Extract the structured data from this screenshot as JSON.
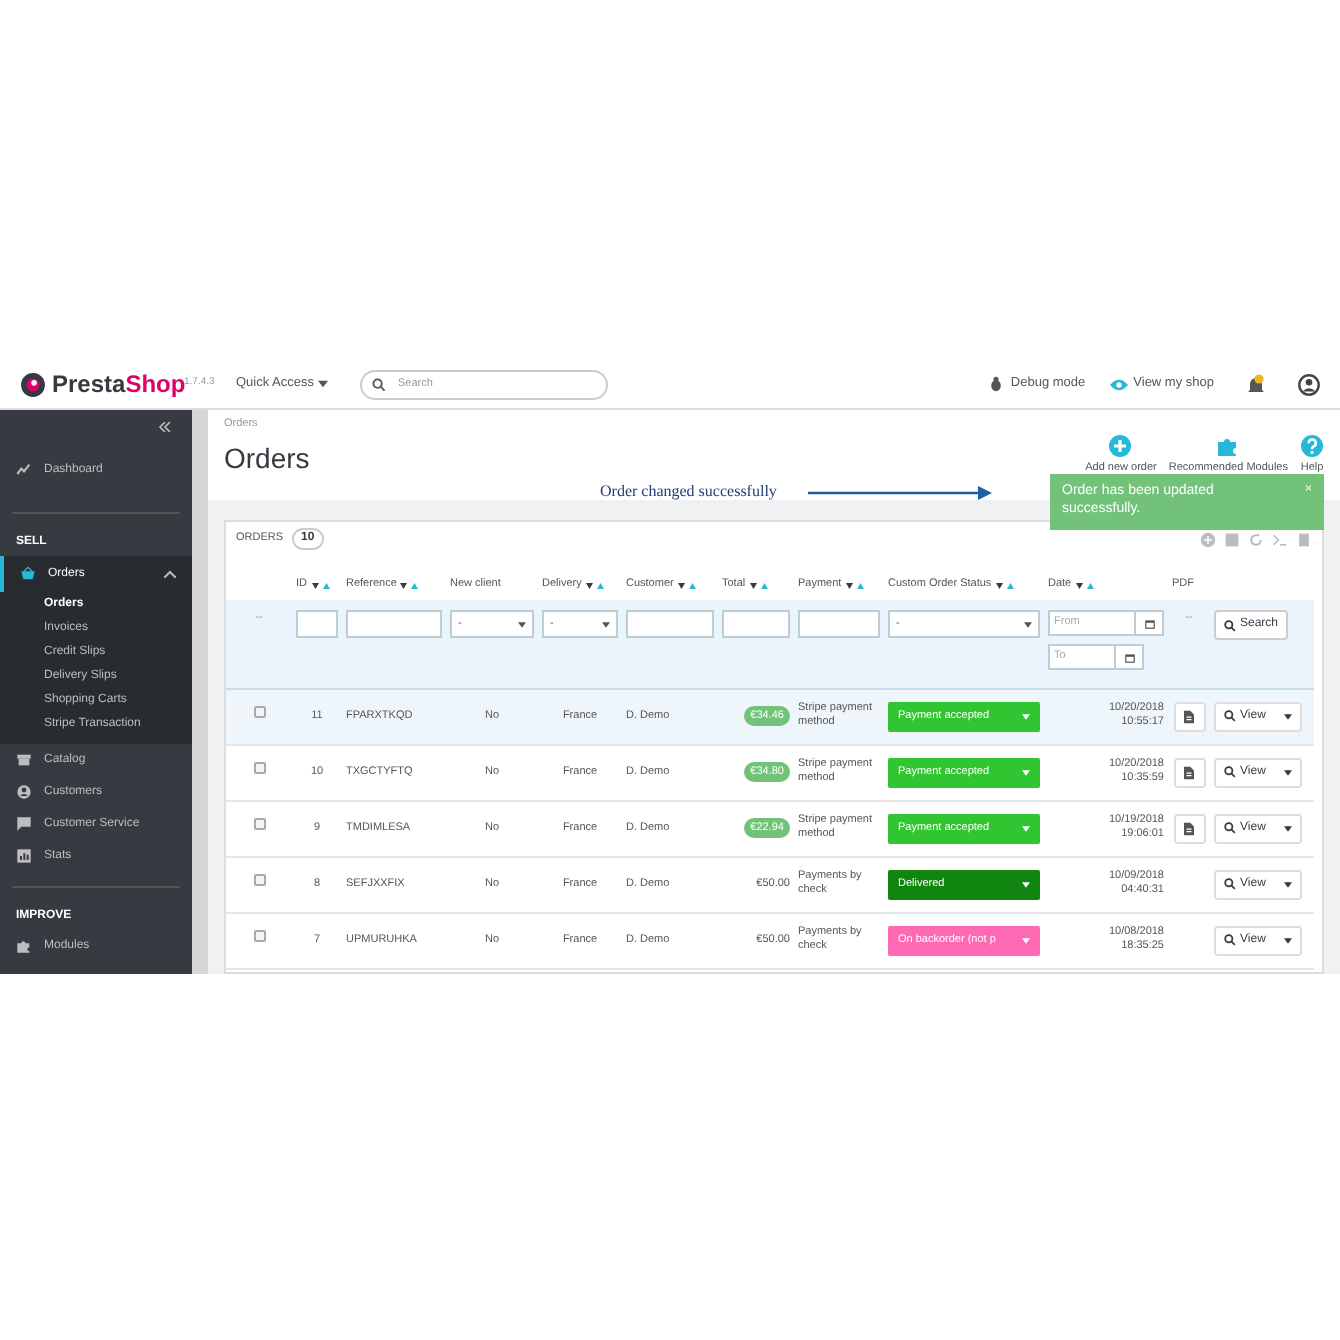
{
  "header": {
    "logo_text": [
      "Presta",
      "Shop"
    ],
    "version": "1.7.4.3",
    "quick_access": "Quick Access",
    "search": {
      "placeholder": "Search"
    },
    "debug_mode": "Debug mode",
    "view_shop": "View my shop"
  },
  "sidebar": {
    "sections": [
      {
        "items": [
          {
            "label": "Dashboard",
            "selected": false
          }
        ]
      },
      {
        "title": "SELL",
        "items": [
          {
            "label": "Orders",
            "selected": true,
            "expanded": true,
            "children": [
              {
                "label": "Orders",
                "selected": true
              },
              {
                "label": "Invoices",
                "selected": false
              },
              {
                "label": "Credit Slips",
                "selected": false
              },
              {
                "label": "Delivery Slips",
                "selected": false
              },
              {
                "label": "Shopping Carts",
                "selected": false
              },
              {
                "label": "Stripe Transaction",
                "selected": false
              }
            ]
          },
          {
            "label": "Catalog",
            "selected": false
          },
          {
            "label": "Customers",
            "selected": false
          },
          {
            "label": "Customer Service",
            "selected": false
          },
          {
            "label": "Stats",
            "selected": false
          }
        ]
      },
      {
        "title": "IMPROVE",
        "items": [
          {
            "label": "Modules",
            "selected": false
          }
        ]
      }
    ]
  },
  "page": {
    "breadcrumb": "Orders",
    "title": "Orders",
    "toolbar": [
      {
        "label": "Add new order"
      },
      {
        "label": "Recommended Modules"
      },
      {
        "label": "Help"
      }
    ]
  },
  "annotation": "Order changed successfully",
  "toast": {
    "message": "Order has been updated successfully.",
    "close": "×"
  },
  "panel": {
    "title": "ORDERS",
    "count": "10",
    "columns": [
      {
        "label": "ID",
        "sortable": true
      },
      {
        "label": "Reference",
        "sortable": true
      },
      {
        "label": "New client",
        "sortable": false
      },
      {
        "label": "Delivery",
        "sortable": true
      },
      {
        "label": "Customer",
        "sortable": true
      },
      {
        "label": "Total",
        "sortable": true
      },
      {
        "label": "Payment",
        "sortable": true
      },
      {
        "label": "Custom Order Status",
        "sortable": true
      },
      {
        "label": "Date",
        "sortable": true
      },
      {
        "label": "PDF",
        "sortable": false
      }
    ],
    "filters": [
      {
        "kind": "dash",
        "text": "--"
      },
      {
        "kind": "text"
      },
      {
        "kind": "text"
      },
      {
        "kind": "select",
        "value": "-"
      },
      {
        "kind": "select",
        "value": "-"
      },
      {
        "kind": "text"
      },
      {
        "kind": "text"
      },
      {
        "kind": "text"
      },
      {
        "kind": "select",
        "value": "-"
      },
      {
        "kind": "date",
        "fields": [
          {
            "placeholder": "From"
          },
          {
            "placeholder": "To"
          }
        ]
      },
      {
        "kind": "dash",
        "text": "--"
      },
      {
        "kind": "button",
        "label": "Search"
      }
    ],
    "rows": [
      {
        "highlighted": true,
        "checked": false,
        "id": "11",
        "reference": "FPARXTKQD",
        "new_client": "No",
        "delivery": "France",
        "customer": "D. Demo",
        "total": "€34.46",
        "badge": true,
        "payment": "Stripe payment method",
        "status": {
          "label": "Payment accepted",
          "color": "#32c532"
        },
        "date": "10/20/2018",
        "time": "10:55:17",
        "pdf": true,
        "action": "View"
      },
      {
        "highlighted": false,
        "checked": false,
        "id": "10",
        "reference": "TXGCTYFTQ",
        "new_client": "No",
        "delivery": "France",
        "customer": "D. Demo",
        "total": "€34.80",
        "badge": true,
        "payment": "Stripe payment method",
        "status": {
          "label": "Payment accepted",
          "color": "#32c532"
        },
        "date": "10/20/2018",
        "time": "10:35:59",
        "pdf": true,
        "action": "View"
      },
      {
        "highlighted": false,
        "checked": false,
        "id": "9",
        "reference": "TMDIMLESA",
        "new_client": "No",
        "delivery": "France",
        "customer": "D. Demo",
        "total": "€22.94",
        "badge": true,
        "payment": "Stripe payment method",
        "status": {
          "label": "Payment accepted",
          "color": "#32c532"
        },
        "date": "10/19/2018",
        "time": "19:06:01",
        "pdf": true,
        "action": "View"
      },
      {
        "highlighted": false,
        "checked": false,
        "id": "8",
        "reference": "SEFJXXFIX",
        "new_client": "No",
        "delivery": "France",
        "customer": "D. Demo",
        "total": "€50.00",
        "badge": false,
        "payment": "Payments by check",
        "status": {
          "label": "Delivered",
          "color": "#108510"
        },
        "date": "10/09/2018",
        "time": "04:40:31",
        "pdf": false,
        "action": "View"
      },
      {
        "highlighted": false,
        "checked": false,
        "id": "7",
        "reference": "UPMURUHKA",
        "new_client": "No",
        "delivery": "France",
        "customer": "D. Demo",
        "total": "€50.00",
        "badge": false,
        "payment": "Payments by check",
        "status": {
          "label": "On backorder (not p",
          "color": "#ff69b4"
        },
        "date": "10/08/2018",
        "time": "18:35:25",
        "pdf": false,
        "action": "View"
      }
    ]
  }
}
